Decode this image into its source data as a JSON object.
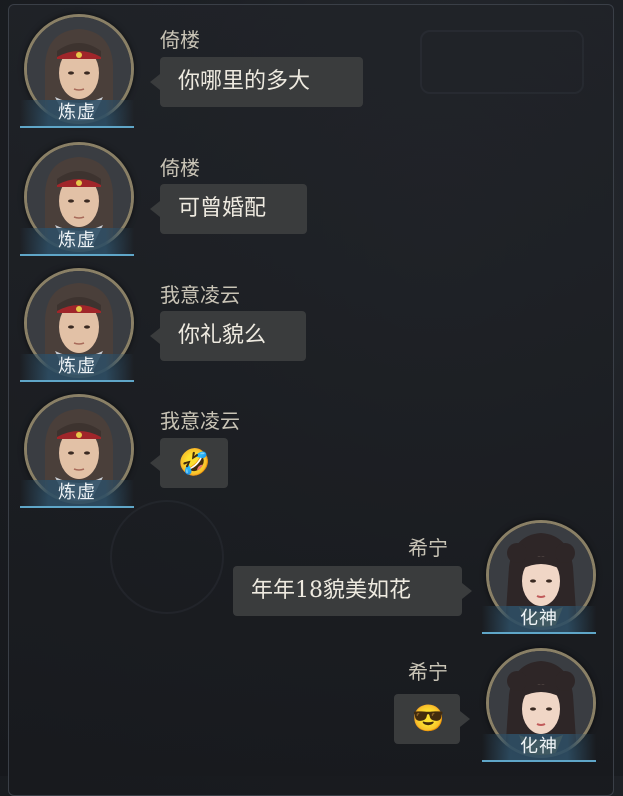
{
  "messages": [
    {
      "side": "left",
      "sender": "倚楼",
      "rank": "炼虚",
      "text": "你哪里的多大",
      "type": "text"
    },
    {
      "side": "left",
      "sender": "倚楼",
      "rank": "炼虚",
      "text": "可曾婚配",
      "type": "text"
    },
    {
      "side": "left",
      "sender": "我意凌云",
      "rank": "炼虚",
      "text": "你礼貌么",
      "type": "text"
    },
    {
      "side": "left",
      "sender": "我意凌云",
      "rank": "炼虚",
      "text": "🤣",
      "type": "emoji",
      "icon": "rolling-laughing-emoji"
    },
    {
      "side": "right",
      "sender": "希宁",
      "rank": "化神",
      "text": "年年18貌美如花",
      "type": "text"
    },
    {
      "side": "right",
      "sender": "希宁",
      "rank": "化神",
      "text": "😎",
      "type": "emoji",
      "icon": "sunglasses-emoji"
    }
  ],
  "colors": {
    "bubble": "#3a3c3d",
    "name": "#c9c4b6",
    "rank_bar": "#2e4e64",
    "ring": "#8a8066"
  }
}
